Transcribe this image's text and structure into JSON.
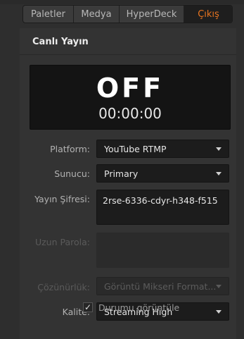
{
  "tabs": [
    {
      "label": "Paletler",
      "active": false
    },
    {
      "label": "Medya",
      "active": false
    },
    {
      "label": "HyperDeck",
      "active": false
    },
    {
      "label": "Çıkış",
      "active": true
    }
  ],
  "accent_color": "#e8741f",
  "section": {
    "title": "Canlı Yayın"
  },
  "status": {
    "state": "OFF",
    "timecode": "00:00:00"
  },
  "fields": {
    "platform": {
      "label": "Platform:",
      "value": "YouTube RTMP"
    },
    "server": {
      "label": "Sunucu:",
      "value": "Primary"
    },
    "stream_key": {
      "label": "Yayın Şifresi:",
      "value": "2rse-6336-cdyr-h348-f515"
    },
    "long_password": {
      "label": "Uzun Parola:",
      "value": ""
    },
    "resolution": {
      "label": "Çözünürlük:",
      "value": "Görüntü Mikseri Format..."
    },
    "quality": {
      "label": "Kalite:",
      "value": "Streaming High"
    }
  },
  "show_status": {
    "label": "Durumu görüntüle",
    "checked": true
  }
}
